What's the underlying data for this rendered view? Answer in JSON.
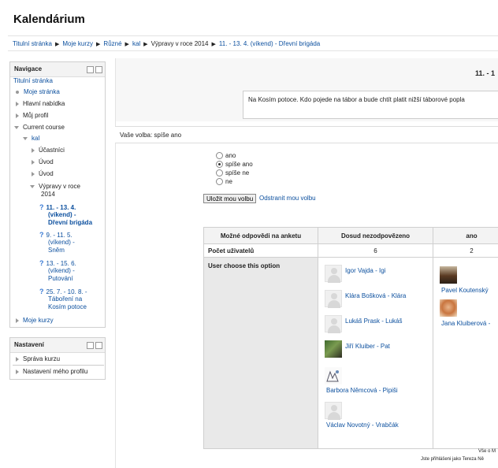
{
  "page": {
    "heading": "Kalendárium"
  },
  "breadcrumb": {
    "items": [
      "Titulní stránka",
      "Moje kurzy",
      "Různé",
      "kal",
      "Výpravy v roce 2014",
      "11. - 13. 4. (víkend) - Dřevní brigáda"
    ]
  },
  "nav_block": {
    "title": "Navigace",
    "items": {
      "home": "Titulní stránka",
      "my_page": "Moje stránka",
      "main_menu": "Hlavní nabídka",
      "my_profile": "Můj profil",
      "current_course": "Current course",
      "kal": "kal",
      "participants": "Účastníci",
      "intro1": "Úvod",
      "intro2": "Úvod",
      "trips_l1": "Výpravy v roce",
      "trips_l2": "2014",
      "act1_l1": "11. - 13. 4.",
      "act1_l2": "(víkend) -",
      "act1_l3": "Dřevní brigáda",
      "act2_l1": "9. - 11. 5.",
      "act2_l2": "(víkend) -",
      "act2_l3": "Sněm",
      "act3_l1": "13. - 15. 6.",
      "act3_l2": "(víkend) -",
      "act3_l3": "Putování",
      "act4_l1": "25. 7. - 10. 8. -",
      "act4_l2": "Táboření na",
      "act4_l3": "Kosím potoce",
      "my_courses": "Moje kurzy"
    }
  },
  "settings_block": {
    "title": "Nastavení",
    "items": [
      "Správa kurzu",
      "Nastavení mého profilu"
    ]
  },
  "choice": {
    "title": "11. - 1",
    "intro": "Na Kosím potoce. Kdo pojede na tábor a bude chtít platit nižší táborové popla",
    "your_choice": "Vaše volba: spíše ano",
    "options": [
      "ano",
      "spíše ano",
      "spíše ne",
      "ne"
    ],
    "selected_index": 1,
    "save_label": "Uložit mou volbu",
    "remove_label": "Odstranit mou volbu"
  },
  "results": {
    "col_header_label": "Možné odpovědi na anketu",
    "col_not_answered": "Dosud nezodpovězeno",
    "col_ano": "ano",
    "row_count_label": "Počet uživatelů",
    "count_not_answered": "6",
    "count_ano": "2",
    "row_users_label": "User choose this option",
    "not_answered_users": [
      "Igor Vajda - Igi",
      "Klára Bošková - Klára",
      "Lukáš Prask - Lukáš",
      "Jiří Kluiber - Pat",
      "Barbora Němcová - Pipiši",
      "Václav Novotný - Vrabčák"
    ],
    "ano_users": [
      "Pavel Koutenský",
      "Jana Kluiberová -"
    ]
  },
  "footer": {
    "line1": "Vše o M",
    "line2": "Jste přihlášeni jako Tereza Ně"
  }
}
